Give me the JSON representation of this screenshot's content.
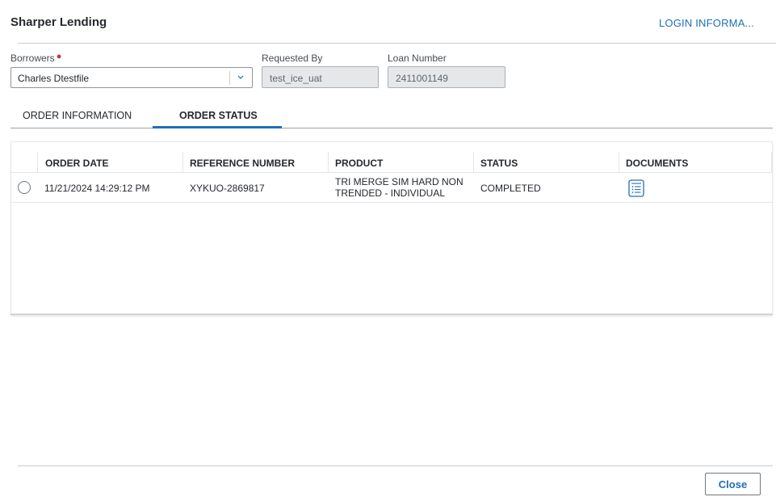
{
  "header": {
    "title": "Sharper Lending",
    "login_link": "LOGIN INFORMA..."
  },
  "form": {
    "borrowers": {
      "label": "Borrowers",
      "value": "Charles Dtestfile",
      "required": true
    },
    "requested_by": {
      "label": "Requested By",
      "value": "test_ice_uat"
    },
    "loan_number": {
      "label": "Loan Number",
      "value": "2411001149"
    }
  },
  "tabs": [
    {
      "label": "ORDER INFORMATION",
      "active": false
    },
    {
      "label": "ORDER STATUS",
      "active": true
    }
  ],
  "table": {
    "columns": [
      "ORDER DATE",
      "REFERENCE NUMBER",
      "PRODUCT",
      "STATUS",
      "DOCUMENTS"
    ],
    "rows": [
      {
        "selected": false,
        "order_date": "11/21/2024 14:29:12 PM",
        "reference_number": "XYKUO-2869817",
        "product_line1": "TRI MERGE SIM HARD NON",
        "product_line2": "TRENDED - INDIVIDUAL",
        "status": "COMPLETED",
        "documents_icon": "document-list-icon"
      }
    ]
  },
  "footer": {
    "close_label": "Close"
  },
  "colors": {
    "accent": "#1e6fb8",
    "required": "#c4342d",
    "text": "#25292f"
  }
}
